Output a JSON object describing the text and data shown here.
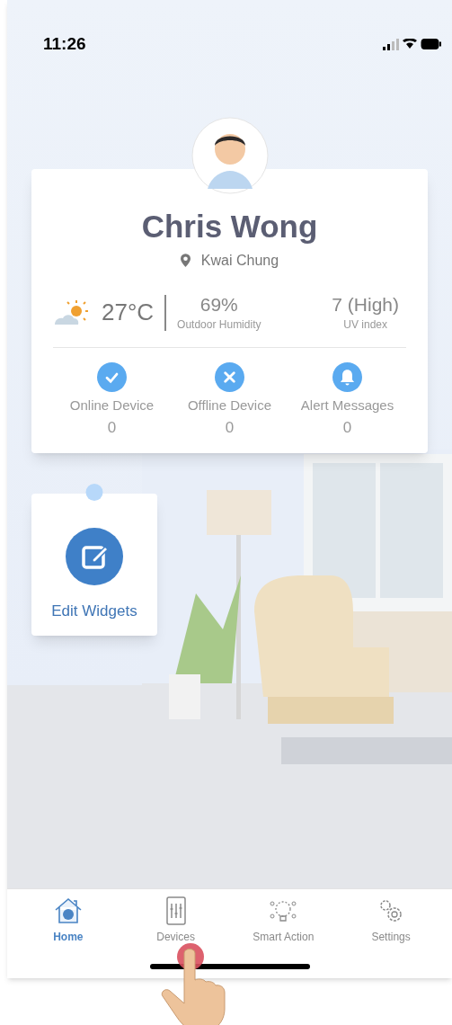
{
  "status_bar": {
    "time": "11:26"
  },
  "profile": {
    "name": "Chris Wong",
    "location": "Kwai Chung"
  },
  "weather": {
    "temperature": "27°C",
    "humidity": {
      "value": "69%",
      "label": "Outdoor Humidity"
    },
    "uv": {
      "value": "7 (High)",
      "label": "UV index"
    }
  },
  "stats": [
    {
      "kind": "online",
      "label": "Online Device",
      "count": "0"
    },
    {
      "kind": "offline",
      "label": "Offline Device",
      "count": "0"
    },
    {
      "kind": "alert",
      "label": "Alert Messages",
      "count": "0"
    }
  ],
  "widget": {
    "label": "Edit Widgets"
  },
  "tabs": [
    {
      "kind": "home",
      "label": "Home",
      "selected": true
    },
    {
      "kind": "devices",
      "label": "Devices",
      "selected": false
    },
    {
      "kind": "smart",
      "label": "Smart Action",
      "selected": false
    },
    {
      "kind": "settings",
      "label": "Settings",
      "selected": false
    }
  ]
}
